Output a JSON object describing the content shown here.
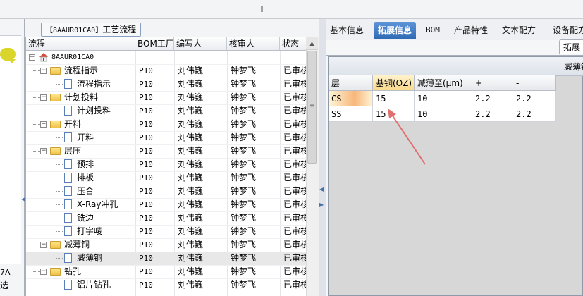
{
  "top": {
    "handle": "|||"
  },
  "left_panel": {
    "label1": "7A",
    "label2": "选"
  },
  "middle": {
    "title_code": "【8AAUR01CA0】",
    "title_text": "工艺流程",
    "columns": [
      "流程",
      "BOM工厂",
      "编写人",
      "核审人",
      "状态"
    ],
    "rows": [
      {
        "level": 0,
        "kind": "root",
        "name": "8AAUR01CA0",
        "plant": "",
        "writer": "",
        "reviewer": "",
        "status": ""
      },
      {
        "level": 1,
        "kind": "folder",
        "name": "流程指示",
        "plant": "P10",
        "writer": "刘伟巍",
        "reviewer": "钟梦飞",
        "status": "已审核"
      },
      {
        "level": 2,
        "kind": "doc",
        "name": "流程指示",
        "plant": "P10",
        "writer": "刘伟巍",
        "reviewer": "钟梦飞",
        "status": "已审核"
      },
      {
        "level": 1,
        "kind": "folder",
        "name": "计划投料",
        "plant": "P10",
        "writer": "刘伟巍",
        "reviewer": "钟梦飞",
        "status": "已审核"
      },
      {
        "level": 2,
        "kind": "doc",
        "name": "计划投料",
        "plant": "P10",
        "writer": "刘伟巍",
        "reviewer": "钟梦飞",
        "status": "已审核"
      },
      {
        "level": 1,
        "kind": "folder",
        "name": "开料",
        "plant": "P10",
        "writer": "刘伟巍",
        "reviewer": "钟梦飞",
        "status": "已审核"
      },
      {
        "level": 2,
        "kind": "doc",
        "name": "开料",
        "plant": "P10",
        "writer": "刘伟巍",
        "reviewer": "钟梦飞",
        "status": "已审核"
      },
      {
        "level": 1,
        "kind": "folder",
        "name": "层压",
        "plant": "P10",
        "writer": "刘伟巍",
        "reviewer": "钟梦飞",
        "status": "已审核"
      },
      {
        "level": 2,
        "kind": "doc",
        "name": "预排",
        "plant": "P10",
        "writer": "刘伟巍",
        "reviewer": "钟梦飞",
        "status": "已审核"
      },
      {
        "level": 2,
        "kind": "doc",
        "name": "排板",
        "plant": "P10",
        "writer": "刘伟巍",
        "reviewer": "钟梦飞",
        "status": "已审核"
      },
      {
        "level": 2,
        "kind": "doc",
        "name": "压合",
        "plant": "P10",
        "writer": "刘伟巍",
        "reviewer": "钟梦飞",
        "status": "已审核"
      },
      {
        "level": 2,
        "kind": "doc",
        "name": "X-Ray冲孔",
        "plant": "P10",
        "writer": "刘伟巍",
        "reviewer": "钟梦飞",
        "status": "已审核"
      },
      {
        "level": 2,
        "kind": "doc",
        "name": "铣边",
        "plant": "P10",
        "writer": "刘伟巍",
        "reviewer": "钟梦飞",
        "status": "已审核"
      },
      {
        "level": 2,
        "kind": "doc",
        "name": "打字唛",
        "plant": "P10",
        "writer": "刘伟巍",
        "reviewer": "钟梦飞",
        "status": "已审核"
      },
      {
        "level": 1,
        "kind": "folder",
        "name": "减薄铜",
        "plant": "P10",
        "writer": "刘伟巍",
        "reviewer": "钟梦飞",
        "status": "已审核"
      },
      {
        "level": 2,
        "kind": "doc",
        "name": "减薄铜",
        "plant": "P10",
        "writer": "刘伟巍",
        "reviewer": "钟梦飞",
        "status": "已审核",
        "selected": true
      },
      {
        "level": 1,
        "kind": "folder",
        "name": "钻孔",
        "plant": "P10",
        "writer": "刘伟巍",
        "reviewer": "钟梦飞",
        "status": "已审核"
      },
      {
        "level": 2,
        "kind": "doc",
        "name": "铝片钻孔",
        "plant": "P10",
        "writer": "刘伟巍",
        "reviewer": "钟梦飞",
        "status": "已审核"
      }
    ]
  },
  "right": {
    "tabs": [
      {
        "label": "基本信息",
        "active": false
      },
      {
        "label": "拓展信息",
        "active": true
      },
      {
        "label": "BOM",
        "active": false
      },
      {
        "label": "产品特性",
        "active": false
      },
      {
        "label": "文本配方",
        "active": false
      },
      {
        "label": "设备配方",
        "active": false
      }
    ],
    "sub_tab": "拓展",
    "grid_caption": "减薄铜",
    "columns": [
      "层",
      "基铜(OZ)",
      "减薄至(μm)",
      "+",
      "-"
    ],
    "rows": [
      [
        "CS",
        "15",
        "10",
        "2.2",
        "2.2"
      ],
      [
        "SS",
        "15",
        "10",
        "2.2",
        "2.2"
      ]
    ],
    "highlight_color": "#f7b77b",
    "arrow_color": "#e07070"
  }
}
